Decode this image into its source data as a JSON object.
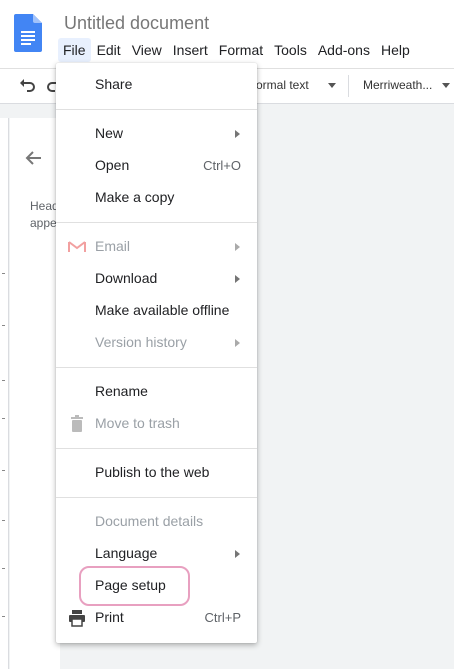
{
  "document": {
    "title": "Untitled document"
  },
  "menubar": [
    "File",
    "Edit",
    "View",
    "Insert",
    "Format",
    "Tools",
    "Add-ons",
    "Help"
  ],
  "toolbar": {
    "style_label": "ormal text",
    "font_label": "Merriweath..."
  },
  "outline": {
    "text_line1": "Head",
    "text_line2": "appe"
  },
  "file_menu": {
    "share": "Share",
    "new": "New",
    "open": "Open",
    "open_shortcut": "Ctrl+O",
    "make_copy": "Make a copy",
    "email": "Email",
    "download": "Download",
    "make_offline": "Make available offline",
    "version_history": "Version history",
    "rename": "Rename",
    "move_trash": "Move to trash",
    "publish": "Publish to the web",
    "doc_details": "Document details",
    "language": "Language",
    "page_setup": "Page setup",
    "print": "Print",
    "print_shortcut": "Ctrl+P"
  },
  "colors": {
    "accent": "#e8a0c0",
    "menu_active": "#e8f0fe",
    "docs_blue": "#4285f4"
  },
  "icons": [
    "docs-logo-icon",
    "undo-icon",
    "redo-icon",
    "back-arrow-icon",
    "gmail-icon",
    "trash-icon",
    "printer-icon"
  ]
}
